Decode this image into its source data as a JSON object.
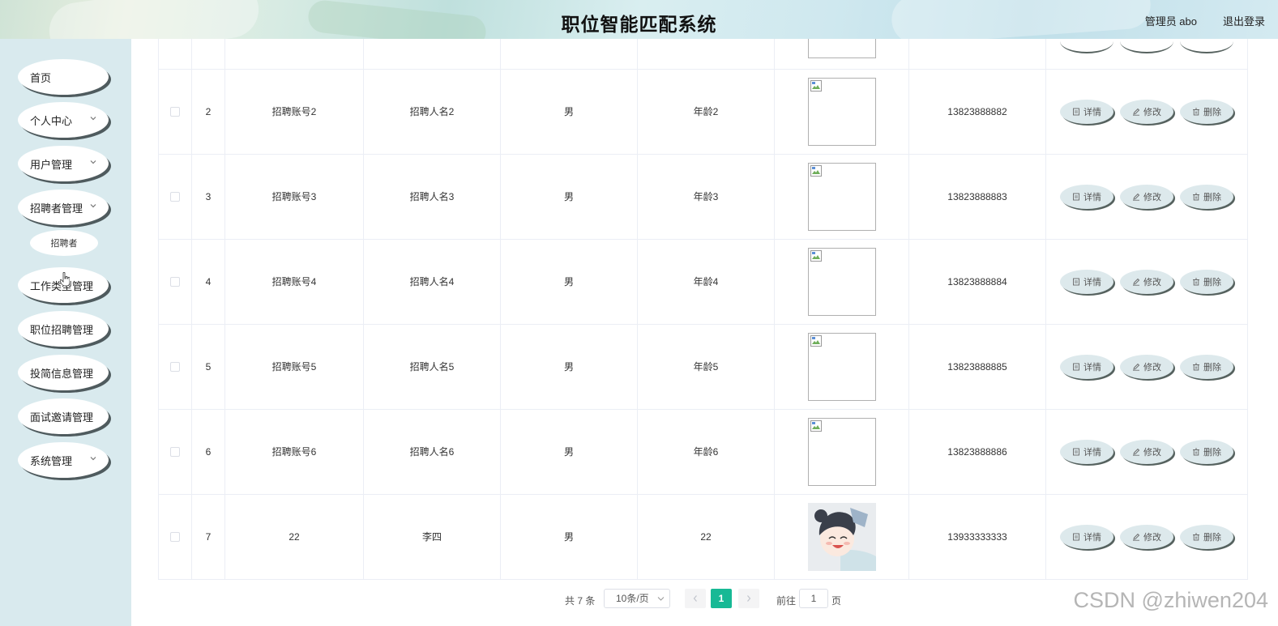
{
  "header": {
    "title": "职位智能匹配系统",
    "admin_label": "管理员 abo",
    "logout_label": "退出登录"
  },
  "sidebar": {
    "items": [
      {
        "label": "首页",
        "has_chevron": false
      },
      {
        "label": "个人中心",
        "has_chevron": true
      },
      {
        "label": "用户管理",
        "has_chevron": true
      },
      {
        "label": "招聘者管理",
        "has_chevron": true
      },
      {
        "label": "工作类型管理",
        "has_chevron": false
      },
      {
        "label": "职位招聘管理",
        "has_chevron": false
      },
      {
        "label": "投简信息管理",
        "has_chevron": false
      },
      {
        "label": "面试邀请管理",
        "has_chevron": false
      },
      {
        "label": "系统管理",
        "has_chevron": true
      }
    ],
    "submenu": {
      "label": "招聘者"
    }
  },
  "table": {
    "rows": [
      {
        "index": "2",
        "account": "招聘账号2",
        "name": "招聘人名2",
        "gender": "男",
        "age": "年龄2",
        "photo": "broken-image",
        "phone": "13823888882"
      },
      {
        "index": "3",
        "account": "招聘账号3",
        "name": "招聘人名3",
        "gender": "男",
        "age": "年龄3",
        "photo": "broken-image",
        "phone": "13823888883"
      },
      {
        "index": "4",
        "account": "招聘账号4",
        "name": "招聘人名4",
        "gender": "男",
        "age": "年龄4",
        "photo": "broken-image",
        "phone": "13823888884"
      },
      {
        "index": "5",
        "account": "招聘账号5",
        "name": "招聘人名5",
        "gender": "男",
        "age": "年龄5",
        "photo": "broken-image",
        "phone": "13823888885"
      },
      {
        "index": "6",
        "account": "招聘账号6",
        "name": "招聘人名6",
        "gender": "男",
        "age": "年龄6",
        "photo": "broken-image",
        "phone": "13823888886"
      },
      {
        "index": "7",
        "account": "22",
        "name": "李四",
        "gender": "男",
        "age": "22",
        "photo": "anime-avatar",
        "phone": "13933333333"
      }
    ],
    "actions": {
      "detail": "详情",
      "edit": "修改",
      "delete": "删除"
    }
  },
  "pagination": {
    "total": "共 7 条",
    "page_size": "10条/页",
    "current_page": "1",
    "goto_label": "前往",
    "goto_value": "1",
    "page_suffix": "页"
  },
  "watermark": "CSDN @zhiwen204",
  "colors": {
    "sidebar_bg": "#d9eaee",
    "accent": "#17b995",
    "button_bg": "#dde9ec"
  }
}
